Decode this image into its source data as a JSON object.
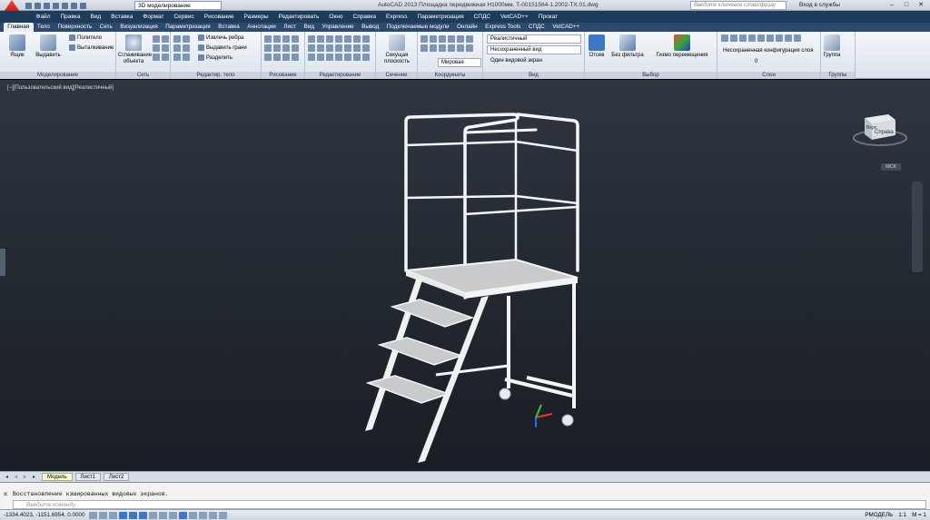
{
  "app": {
    "window_title": "AutoCAD 2013   Площадка передвижная Н1000мм. Т-00151564-1.2002-TX.01.dwg",
    "workspace": "3D моделирование",
    "search_placeholder": "Введите ключевое слово/фразу",
    "signin": "Вход в службы"
  },
  "menubar": [
    "Файл",
    "Правка",
    "Вид",
    "Вставка",
    "Формат",
    "Сервис",
    "Рисование",
    "Размеры",
    "Редактировать",
    "Окно",
    "Справка",
    "Express",
    "Параметризация",
    "СПДС",
    "VetCAD++",
    "Прокат"
  ],
  "ribbon_tabs": [
    "Главная",
    "Тело",
    "Поверхность",
    "Сеть",
    "Визуализация",
    "Параметризация",
    "Вставка",
    "Аннотации",
    "Лист",
    "Вид",
    "Управление",
    "Вывод",
    "Подключаемые модули",
    "Онлайн",
    "Express Tools",
    "СПДС",
    "VetCAD++"
  ],
  "active_tab": "Главная",
  "panels": {
    "modeling": {
      "title": "Моделирование",
      "box": "Ящик",
      "extrude": "Выдавить",
      "polysolid": "Политело",
      "presspull": "Выталкивание"
    },
    "mesh": {
      "title": "Сеть",
      "smooth": "Сглаживание объекта"
    },
    "solid_edit": {
      "title": "Редактир. тело",
      "extract_edges": "Извлечь ребра",
      "extrude_faces": "Выдавить грани",
      "separate": "Разделить"
    },
    "draw": {
      "title": "Рисование"
    },
    "modify": {
      "title": "Редактирование"
    },
    "section": {
      "title": "Сечение",
      "plane": "Секущая плоскость"
    },
    "coordinates": {
      "title": "Координаты",
      "world": "Мировая"
    },
    "view": {
      "title": "Вид",
      "visual_style": "Реалистичный",
      "named_view": "Несохраненный вид",
      "viewports": "Один видовой экран"
    },
    "selection": {
      "title": "Выбор",
      "culling": "Отсев",
      "no_filter": "Без фильтра",
      "gizmo": "Гизмо перемещения"
    },
    "layers": {
      "title": "Слои",
      "layer_state": "Несохраненная конфигурация слоя",
      "current_layer": "0"
    },
    "groups": {
      "title": "Группы",
      "group": "Группа"
    }
  },
  "viewport": {
    "label": "[−][Пользовательский вид][Реалистичный]",
    "viewcube_face": "Справа",
    "viewcube_top": "Верх",
    "wcs": "МСК"
  },
  "layout_tabs": [
    "Модель",
    "Лист1",
    "Лист2"
  ],
  "active_layout": "Модель",
  "command": {
    "history": "Восстановление кэшированных видовых экранов.",
    "placeholder": "Введите команду"
  },
  "status": {
    "coords": "-1334.4023, -1151.6954, 0.0000",
    "mode": "РМОДЕЛЬ",
    "scale": "1:1",
    "annoscale": "М = 1"
  },
  "colors": {
    "menubar": "#1f3b5c",
    "tabsbar": "#2c4a6e",
    "viewport_top": "#2f3640",
    "model_tab": "#f8fdc8"
  }
}
